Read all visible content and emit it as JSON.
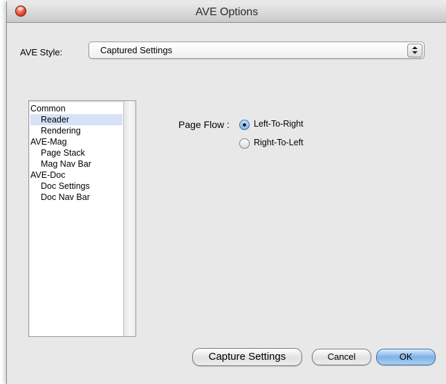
{
  "window": {
    "title": "AVE Options"
  },
  "ave_style": {
    "label": "AVE Style:",
    "selected": "Captured Settings"
  },
  "categories": [
    {
      "label": "Common",
      "level": 0,
      "selected": false
    },
    {
      "label": "Reader",
      "level": 1,
      "selected": true
    },
    {
      "label": "Rendering",
      "level": 1,
      "selected": false
    },
    {
      "label": "AVE-Mag",
      "level": 0,
      "selected": false
    },
    {
      "label": "Page Stack",
      "level": 1,
      "selected": false
    },
    {
      "label": "Mag Nav Bar",
      "level": 1,
      "selected": false
    },
    {
      "label": "AVE-Doc",
      "level": 0,
      "selected": false
    },
    {
      "label": "Doc Settings",
      "level": 1,
      "selected": false
    },
    {
      "label": "Doc Nav Bar",
      "level": 1,
      "selected": false
    }
  ],
  "page_flow": {
    "label": "Page Flow :",
    "options": [
      {
        "label": "Left-To-Right",
        "checked": true
      },
      {
        "label": "Right-To-Left",
        "checked": false
      }
    ]
  },
  "buttons": {
    "capture": "Capture Settings",
    "cancel": "Cancel",
    "ok": "OK"
  }
}
